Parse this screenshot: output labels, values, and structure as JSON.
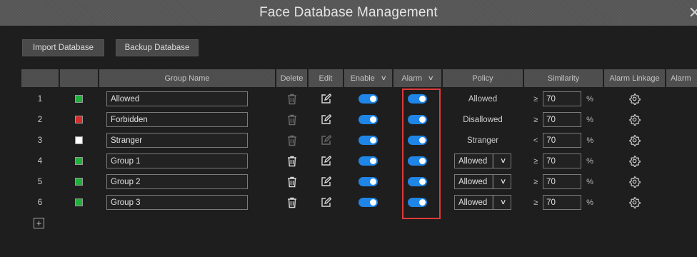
{
  "window": {
    "title": "Face Database Management",
    "close_glyph": "✕"
  },
  "toolbar": {
    "import_label": "Import Database",
    "backup_label": "Backup Database"
  },
  "headers": {
    "index": "",
    "color": "",
    "group_name": "Group Name",
    "delete": "Delete",
    "edit": "Edit",
    "enable": "Enable",
    "alarm": "Alarm",
    "policy": "Policy",
    "similarity": "Similarity",
    "alarm_linkage": "Alarm Linkage",
    "alarm_extra": "Alarm"
  },
  "colors": {
    "accent": "#1f86e8",
    "green": "#20b03c",
    "red": "#d62d2d",
    "white": "#ffffff",
    "highlight": "#e03a3a"
  },
  "rows": [
    {
      "index": "1",
      "color": "green",
      "name": "Allowed",
      "delete_enabled": false,
      "edit_enabled": true,
      "enable": true,
      "alarm": true,
      "policy": "Allowed",
      "policy_editable": false,
      "op": "≥",
      "similarity": "70",
      "unit": "%"
    },
    {
      "index": "2",
      "color": "red",
      "name": "Forbidden",
      "delete_enabled": false,
      "edit_enabled": true,
      "enable": true,
      "alarm": true,
      "policy": "Disallowed",
      "policy_editable": false,
      "op": "≥",
      "similarity": "70",
      "unit": "%"
    },
    {
      "index": "3",
      "color": "white",
      "name": "Stranger",
      "delete_enabled": false,
      "edit_enabled": false,
      "enable": true,
      "alarm": true,
      "policy": "Stranger",
      "policy_editable": false,
      "op": "<",
      "similarity": "70",
      "unit": "%"
    },
    {
      "index": "4",
      "color": "green",
      "name": "Group 1",
      "delete_enabled": true,
      "edit_enabled": true,
      "enable": true,
      "alarm": true,
      "policy": "Allowed",
      "policy_editable": true,
      "op": "≥",
      "similarity": "70",
      "unit": "%"
    },
    {
      "index": "5",
      "color": "green",
      "name": "Group 2",
      "delete_enabled": true,
      "edit_enabled": true,
      "enable": true,
      "alarm": true,
      "policy": "Allowed",
      "policy_editable": true,
      "op": "≥",
      "similarity": "70",
      "unit": "%"
    },
    {
      "index": "6",
      "color": "green",
      "name": "Group 3",
      "delete_enabled": true,
      "edit_enabled": true,
      "enable": true,
      "alarm": true,
      "policy": "Allowed",
      "policy_editable": true,
      "op": "≥",
      "similarity": "70",
      "unit": "%"
    }
  ],
  "icons": {
    "delete": "trash-icon",
    "edit": "edit-icon",
    "linkage": "gear-icon",
    "add": "plus-icon",
    "dropdown": "chevron-down-icon"
  },
  "footer": {
    "add_glyph": "+"
  }
}
